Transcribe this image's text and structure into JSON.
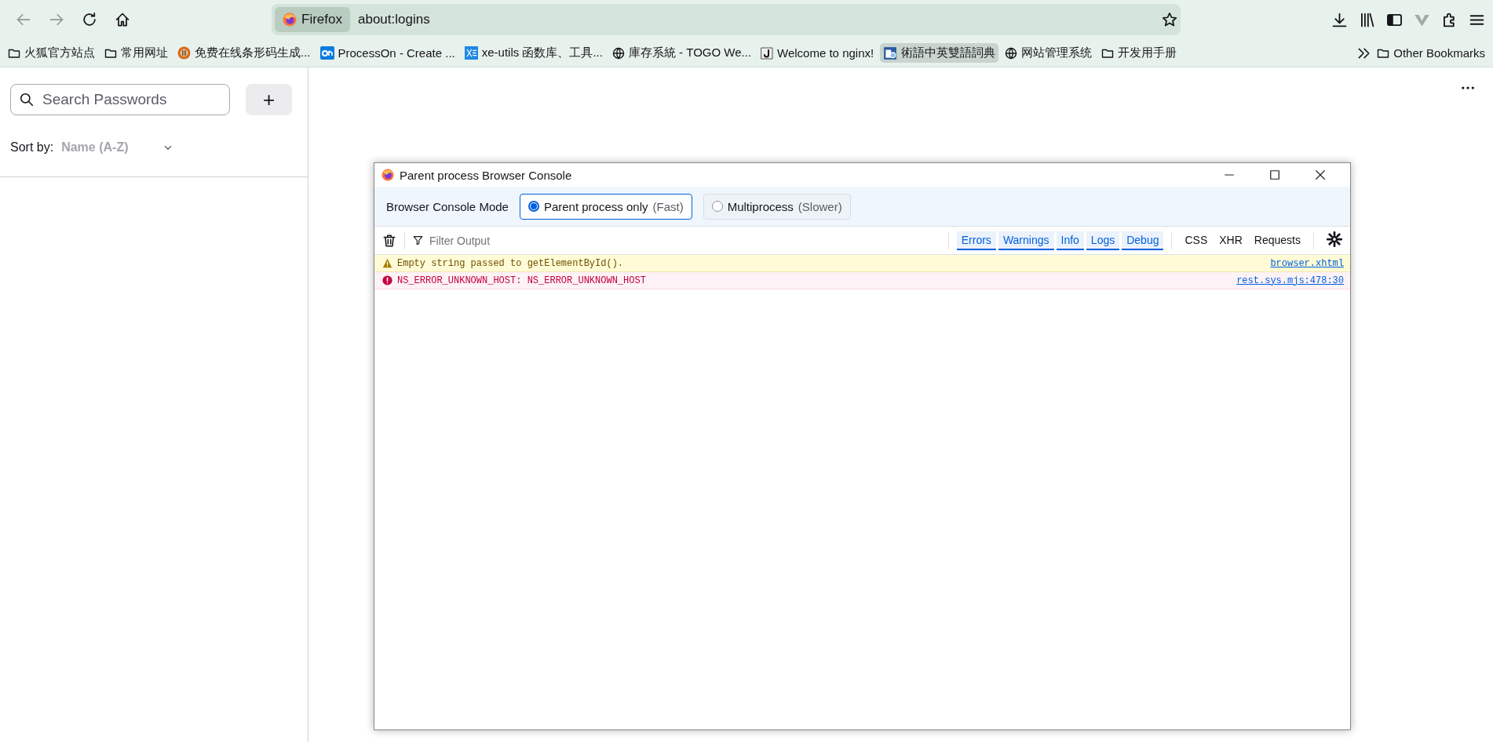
{
  "toolbar": {
    "nav": [
      {
        "kind": "back",
        "disabled": true
      },
      {
        "kind": "forward",
        "disabled": true
      },
      {
        "kind": "reload",
        "disabled": false
      },
      {
        "kind": "home",
        "disabled": false
      }
    ],
    "identity": "Firefox",
    "url": "about:logins",
    "actions": [
      {
        "kind": "download"
      },
      {
        "kind": "library"
      },
      {
        "kind": "sidebar"
      },
      {
        "kind": "extension-v"
      },
      {
        "kind": "puzzle"
      },
      {
        "kind": "menu"
      }
    ]
  },
  "bookmarks": {
    "items": [
      {
        "kind": "folder",
        "label": "火狐官方站点",
        "hovered": false
      },
      {
        "kind": "folder",
        "label": "常用网址",
        "hovered": false
      },
      {
        "kind": "gear",
        "label": "免费在线条形码生成...",
        "hovered": false
      },
      {
        "kind": "on",
        "label": "ProcessOn - Create ...",
        "hovered": false
      },
      {
        "kind": "xe",
        "label": "xe-utils 函数库、工具...",
        "hovered": false
      },
      {
        "kind": "globe",
        "label": "庫存系統 - TOGO We...",
        "hovered": false
      },
      {
        "kind": "j",
        "label": "Welcome to nginx!",
        "hovered": false
      },
      {
        "kind": "book",
        "label": "術語中英雙語詞典",
        "hovered": true
      },
      {
        "kind": "globe",
        "label": "网站管理系统",
        "hovered": false
      },
      {
        "kind": "folder",
        "label": "开发用手册",
        "hovered": false
      }
    ],
    "other": "Other Bookmarks"
  },
  "sidebar": {
    "search_placeholder": "Search Passwords",
    "add_button": "+",
    "sort_label": "Sort by:",
    "sort_value": "Name (A-Z)"
  },
  "console": {
    "title": "Parent process Browser Console",
    "mode_label": "Browser Console Mode",
    "modes": [
      {
        "label": "Parent process only",
        "hint": "(Fast)",
        "selected": true
      },
      {
        "label": "Multiprocess",
        "hint": "(Slower)",
        "selected": false
      }
    ],
    "filter_placeholder": "Filter Output",
    "levels": [
      {
        "label": "Errors",
        "on": true
      },
      {
        "label": "Warnings",
        "on": true
      },
      {
        "label": "Info",
        "on": true
      },
      {
        "label": "Logs",
        "on": true
      },
      {
        "label": "Debug",
        "on": true
      }
    ],
    "types": [
      {
        "label": "CSS",
        "on": false
      },
      {
        "label": "XHR",
        "on": false
      },
      {
        "label": "Requests",
        "on": false
      }
    ],
    "messages": [
      {
        "kind": "warning",
        "text": "Empty string passed to getElementById().",
        "source": "browser.xhtml"
      },
      {
        "kind": "error",
        "text": "NS_ERROR_UNKNOWN_HOST: NS_ERROR_UNKNOWN_HOST",
        "source": "rest.sys.mjs:478:30"
      }
    ]
  }
}
